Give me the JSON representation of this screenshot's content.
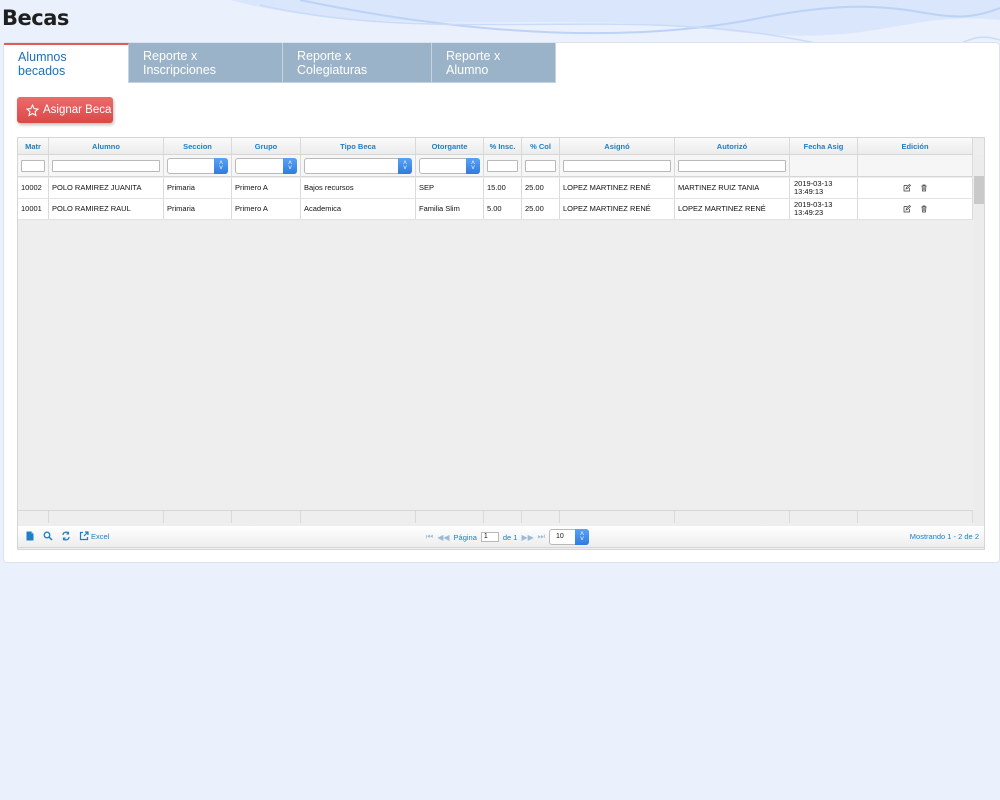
{
  "page": {
    "title": "Becas"
  },
  "tabs": [
    {
      "label": "Alumnos becados",
      "active": true
    },
    {
      "label": "Reporte x Inscripciones",
      "active": false
    },
    {
      "label": "Reporte x Colegiaturas",
      "active": false
    },
    {
      "label": "Reporte x Alumno",
      "active": false
    }
  ],
  "toolbar": {
    "assign_label": "Asignar Beca"
  },
  "grid": {
    "columns": [
      "Matr",
      "Alumno",
      "Seccion",
      "Grupo",
      "Tipo Beca",
      "Otorgante",
      "% Insc.",
      "% Col",
      "Asignó",
      "Autorizó",
      "Fecha Asig",
      "Edición"
    ],
    "rows": [
      {
        "matr": "10002",
        "alumno": "POLO RAMIREZ JUANITA",
        "seccion": "Primaria",
        "grupo": "Primero A",
        "tipo": "Bajos recursos",
        "otorgante": "SEP",
        "insc": "15.00",
        "col": "25.00",
        "asigno": "LOPEZ MARTINEZ RENÉ",
        "autorizo": "MARTINEZ RUIZ TANIA",
        "fecha": "2019-03-13 13:49:13"
      },
      {
        "matr": "10001",
        "alumno": "POLO RAMIREZ RAUL",
        "seccion": "Primaria",
        "grupo": "Primero A",
        "tipo": "Academica",
        "otorgante": "Familia Slim",
        "insc": "5.00",
        "col": "25.00",
        "asigno": "LOPEZ MARTINEZ RENÉ",
        "autorizo": "LOPEZ MARTINEZ RENÉ",
        "fecha": "2019-03-13 13:49:23"
      }
    ]
  },
  "pager": {
    "excel_label": "Excel",
    "page_label": "Página",
    "page_value": "1",
    "of_label": "de 1",
    "rows_per_page": "10",
    "summary": "Mostrando 1 - 2 de 2"
  },
  "colors": {
    "accent_red": "#e25b5b",
    "link_blue": "#1f7ec5",
    "tab_inactive": "#9bb3c9",
    "background": "#eaf1fd"
  }
}
